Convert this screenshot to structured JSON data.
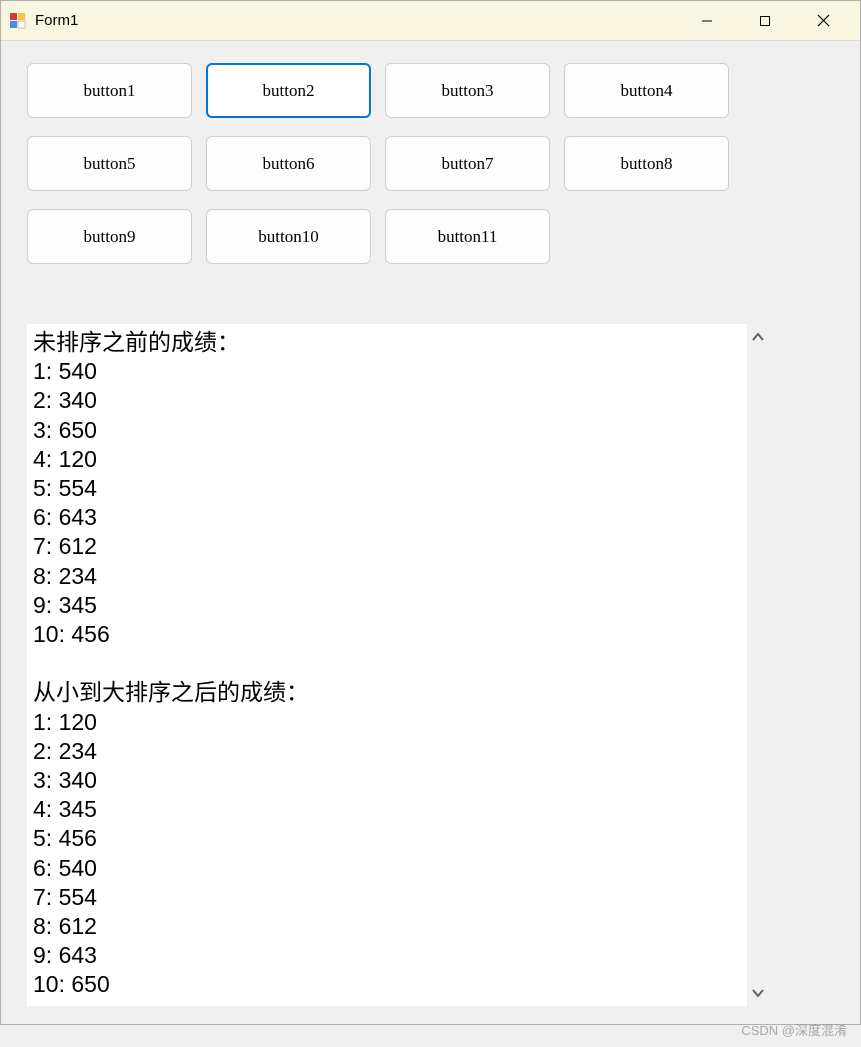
{
  "window": {
    "title": "Form1"
  },
  "buttons": {
    "row1": [
      "button1",
      "button2",
      "button3",
      "button4"
    ],
    "row2": [
      "button5",
      "button6",
      "button7",
      "button8"
    ],
    "row3": [
      "button9",
      "button10",
      "button11"
    ]
  },
  "output": {
    "header1": "未排序之前的成绩：",
    "unsorted": [
      "1: 540",
      "2: 340",
      "3: 650",
      "4: 120",
      "5: 554",
      "6: 643",
      "7: 612",
      "8: 234",
      "9: 345",
      "10: 456"
    ],
    "header2": "从小到大排序之后的成绩：",
    "sorted": [
      "1: 120",
      "2: 234",
      "3: 340",
      "4: 345",
      "5: 456",
      "6: 540",
      "7: 554",
      "8: 612",
      "9: 643",
      "10: 650"
    ]
  },
  "watermark": "CSDN @深度混淆"
}
